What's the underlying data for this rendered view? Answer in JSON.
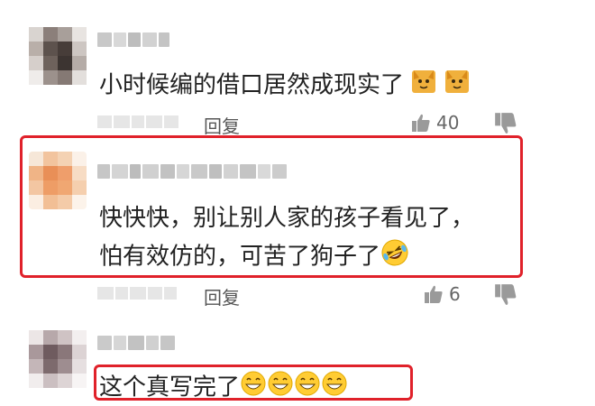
{
  "comments": [
    {
      "text": "小时候编的借口居然成现实了",
      "emoji": [
        "cat-face-icon",
        "cat-face-icon"
      ],
      "reply_label": "回复",
      "likes": "40"
    },
    {
      "text_line1": "快快快，别让别人家的孩子看见了，",
      "text_line2": "怕有效仿的，可苦了狗子了",
      "emoji": [
        "rolling-laughing-face-icon"
      ],
      "reply_label": "回复",
      "likes": "6"
    },
    {
      "text": "这个真写完了",
      "emoji": [
        "grinning-face-icon",
        "grinning-face-icon",
        "grinning-face-icon",
        "grinning-face-icon"
      ]
    }
  ],
  "colors": {
    "highlight": "#e0212a",
    "text": "#222222",
    "meta": "#666666"
  }
}
